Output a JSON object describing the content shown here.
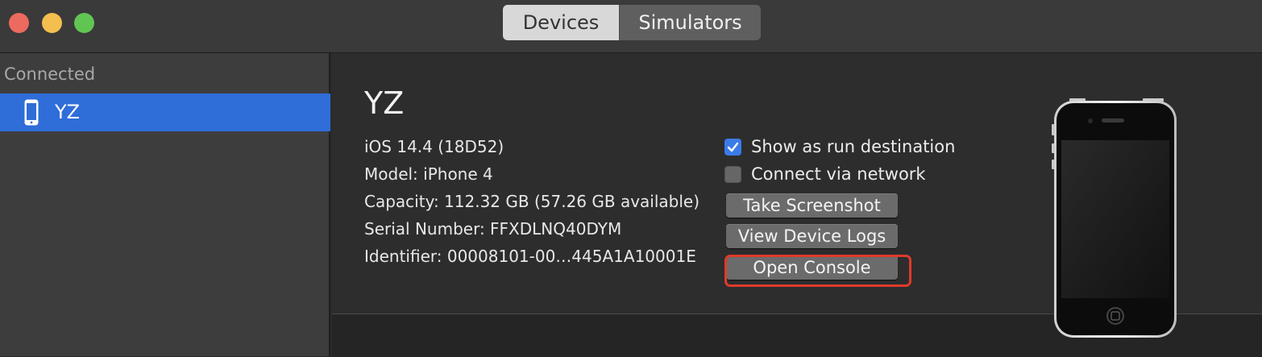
{
  "window": {
    "segmented": {
      "tabs": [
        {
          "label": "Devices",
          "active": true
        },
        {
          "label": "Simulators",
          "active": false
        }
      ]
    }
  },
  "sidebar": {
    "heading": "Connected",
    "items": [
      {
        "label": "YZ",
        "icon": "iphone-icon",
        "selected": true
      }
    ]
  },
  "device": {
    "name": "YZ",
    "info": {
      "ios": "iOS 14.4 (18D52)",
      "model": "Model: iPhone 4",
      "capacity": "Capacity: 112.32 GB (57.26 GB available)",
      "serial": "Serial Number: FFXDLNQ40DYM",
      "identifier": "Identifier: 00008101-00…445A1A10001E"
    },
    "options": {
      "run_destination": {
        "label": "Show as run destination",
        "checked": true
      },
      "via_network": {
        "label": "Connect via network",
        "checked": false
      }
    },
    "actions": {
      "screenshot": "Take Screenshot",
      "logs": "View Device Logs",
      "console": "Open Console"
    }
  },
  "colors": {
    "accent": "#2f6dd9",
    "highlight": "#e03a2a",
    "checkbox": "#3b7be8"
  }
}
